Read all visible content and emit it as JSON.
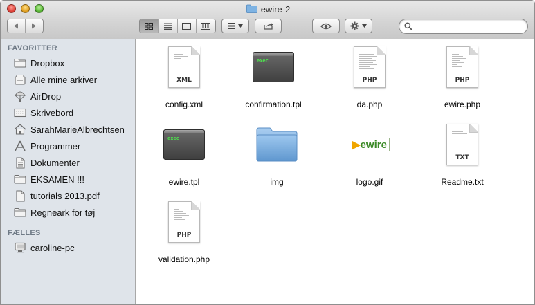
{
  "window": {
    "title": "ewire-2"
  },
  "toolbar": {
    "back_icon": "back-arrow-icon",
    "forward_icon": "forward-arrow-icon",
    "view_modes": [
      "icon-view",
      "list-view",
      "column-view",
      "coverflow-view"
    ],
    "active_view": "icon-view",
    "search_placeholder": ""
  },
  "sidebar": {
    "favorites_header": "FAVORITTER",
    "favorites": [
      {
        "label": "Dropbox",
        "icon": "folder-icon"
      },
      {
        "label": "Alle mine arkiver",
        "icon": "all-files-icon"
      },
      {
        "label": "AirDrop",
        "icon": "airdrop-icon"
      },
      {
        "label": "Skrivebord",
        "icon": "desktop-icon"
      },
      {
        "label": "SarahMarieAlbrechtsen",
        "icon": "home-icon"
      },
      {
        "label": "Programmer",
        "icon": "applications-icon"
      },
      {
        "label": "Dokumenter",
        "icon": "documents-icon"
      },
      {
        "label": "EKSAMEN !!!",
        "icon": "folder-icon"
      },
      {
        "label": "tutorials 2013.pdf",
        "icon": "document-icon"
      },
      {
        "label": "Regneark for tøj",
        "icon": "folder-icon"
      }
    ],
    "shared_header": "FÆLLES",
    "shared": [
      {
        "label": "caroline-pc",
        "icon": "pc-icon"
      }
    ]
  },
  "files": [
    {
      "name": "config.xml",
      "kind": "doc",
      "ext": "XML"
    },
    {
      "name": "confirmation.tpl",
      "kind": "exec",
      "ext": ""
    },
    {
      "name": "da.php",
      "kind": "doc",
      "ext": "PHP"
    },
    {
      "name": "ewire.php",
      "kind": "doc",
      "ext": "PHP"
    },
    {
      "name": "ewire.tpl",
      "kind": "exec",
      "ext": ""
    },
    {
      "name": "img",
      "kind": "folder",
      "ext": ""
    },
    {
      "name": "logo.gif",
      "kind": "image",
      "ext": ""
    },
    {
      "name": "Readme.txt",
      "kind": "doc",
      "ext": "TXT"
    },
    {
      "name": "validation.php",
      "kind": "doc",
      "ext": "PHP"
    }
  ],
  "exec_label": "exec",
  "logo_text": "ewire",
  "colors": {
    "sidebar_bg": "#dfe4ea",
    "section_header": "#6f7a86",
    "folder_blue": "#7eb3e3"
  }
}
